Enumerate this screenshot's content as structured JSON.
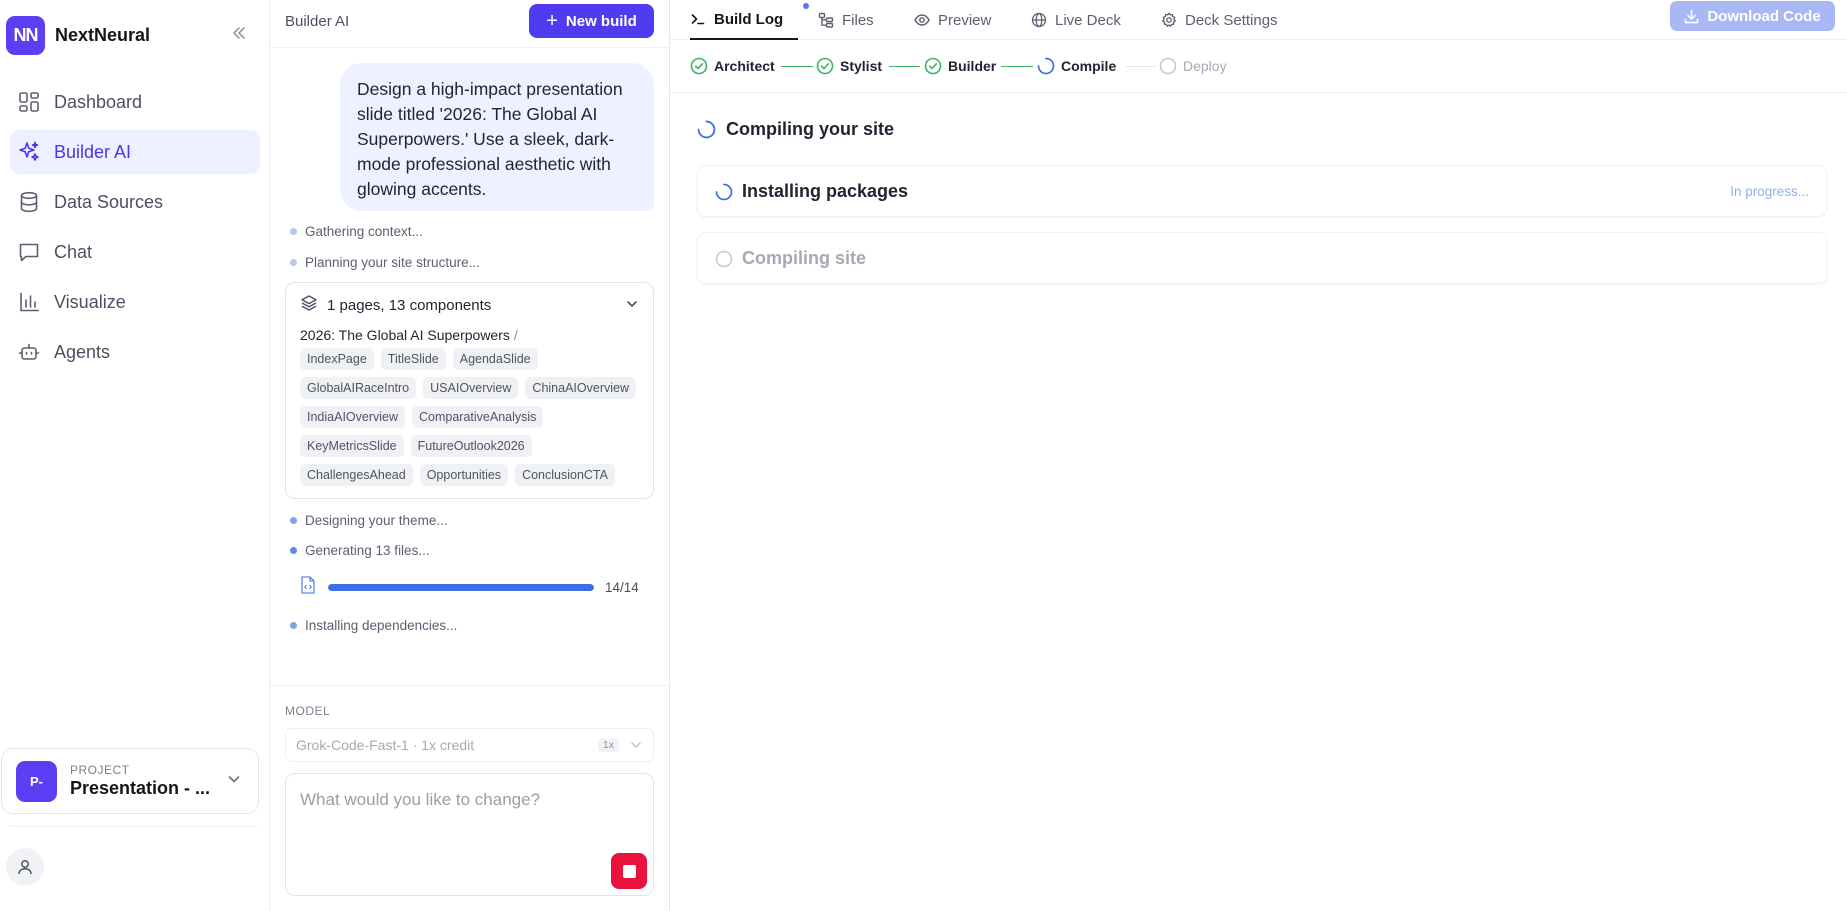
{
  "brand": {
    "logo": "NN",
    "name": "NextNeural"
  },
  "nav": [
    {
      "label": "Dashboard",
      "icon": "dashboard-icon"
    },
    {
      "label": "Builder AI",
      "icon": "sparkles-icon",
      "active": true
    },
    {
      "label": "Data Sources",
      "icon": "database-icon"
    },
    {
      "label": "Chat",
      "icon": "chat-icon"
    },
    {
      "label": "Visualize",
      "icon": "bar-chart-icon"
    },
    {
      "label": "Agents",
      "icon": "robot-icon"
    }
  ],
  "project": {
    "kicker": "PROJECT",
    "avatar": "P-",
    "name": "Presentation - ..."
  },
  "chat": {
    "title": "Builder AI",
    "new_build": "New build",
    "user_message": "Design a high-impact presentation slide titled '2026: The Global AI Superpowers.' Use a sleek, dark-mode professional aesthetic with glowing accents.",
    "steps": [
      "Gathering context...",
      "Planning your site structure...",
      "Designing your theme...",
      "Generating 13 files...",
      "Installing dependencies..."
    ],
    "components": {
      "summary": "1 pages, 13 components",
      "title": "2026: The Global AI Superpowers",
      "separator": "/",
      "items": [
        "IndexPage",
        "TitleSlide",
        "AgendaSlide",
        "GlobalAIRaceIntro",
        "USAIOverview",
        "ChinaAIOverview",
        "IndiaAIOverview",
        "ComparativeAnalysis",
        "KeyMetricsSlide",
        "FutureOutlook2026",
        "ChallengesAhead",
        "Opportunities",
        "ConclusionCTA"
      ]
    },
    "progress": {
      "done": 14,
      "total": 14,
      "label": "14/14"
    },
    "model_label": "MODEL",
    "model_value": "Grok-Code-Fast-1 · 1x credit",
    "model_badge": "1x",
    "prompt_placeholder": "What would you like to change?"
  },
  "main": {
    "tabs": [
      {
        "label": "Build Log",
        "icon": "terminal-icon",
        "active": true
      },
      {
        "label": "Files",
        "icon": "file-tree-icon"
      },
      {
        "label": "Preview",
        "icon": "eye-icon"
      },
      {
        "label": "Live Deck",
        "icon": "globe-icon"
      },
      {
        "label": "Deck Settings",
        "icon": "gear-icon"
      }
    ],
    "download": "Download Code",
    "pipeline": [
      {
        "label": "Architect",
        "status": "done"
      },
      {
        "label": "Stylist",
        "status": "done"
      },
      {
        "label": "Builder",
        "status": "done"
      },
      {
        "label": "Compile",
        "status": "running"
      },
      {
        "label": "Deploy",
        "status": "pending"
      }
    ],
    "log_title": "Compiling your site",
    "log_items": [
      {
        "label": "Installing packages",
        "status": "In progress..."
      },
      {
        "label": "Compiling site",
        "status": ""
      }
    ]
  },
  "colors": {
    "accent": "#4f3cf0",
    "success": "#3fb36b",
    "progress": "#3d6ee6",
    "stop": "#e8123d"
  }
}
